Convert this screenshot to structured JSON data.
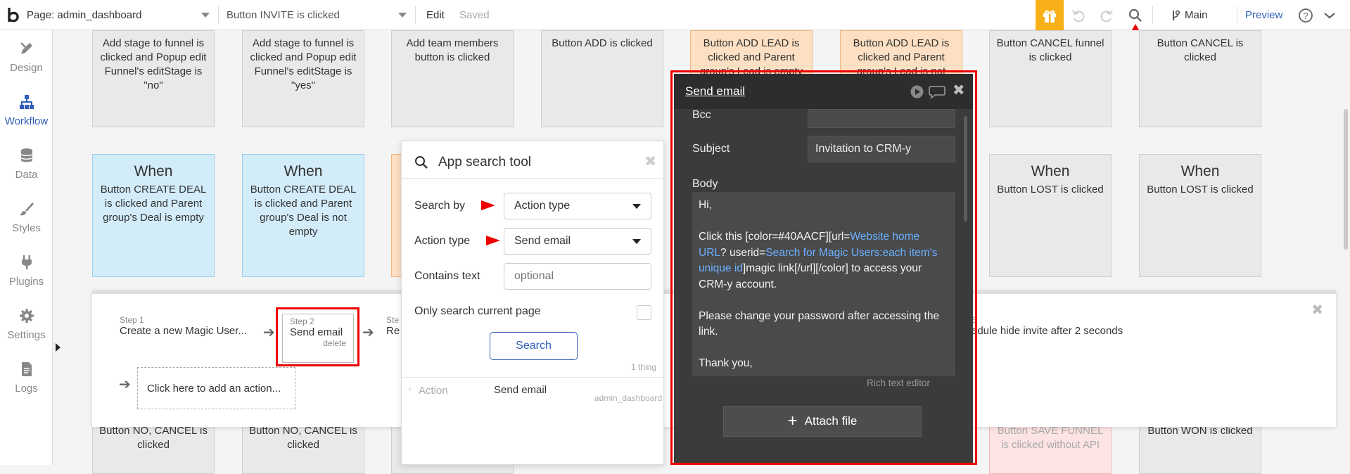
{
  "topbar": {
    "page_label": "Page: admin_dashboard",
    "workflow_label": "Button INVITE is clicked",
    "edit_label": "Edit",
    "saved_label": "Saved",
    "branch_label": "Main",
    "preview_label": "Preview"
  },
  "sidebar": {
    "items": [
      {
        "label": "Design",
        "icon": "design-icon"
      },
      {
        "label": "Workflow",
        "icon": "workflow-icon"
      },
      {
        "label": "Data",
        "icon": "database-icon"
      },
      {
        "label": "Styles",
        "icon": "brush-icon"
      },
      {
        "label": "Plugins",
        "icon": "plug-icon"
      },
      {
        "label": "Settings",
        "icon": "gear-icon"
      },
      {
        "label": "Logs",
        "icon": "document-icon"
      }
    ]
  },
  "cards": {
    "row1": [
      "Add stage to funnel is clicked and Popup edit Funnel's editStage is \"no\"",
      "Add stage to funnel is clicked and Popup edit Funnel's editStage is \"yes\"",
      "Add team members button is clicked",
      "Button ADD is clicked",
      "Button ADD LEAD is clicked and Parent group's Lead is empty",
      "Button ADD LEAD is clicked and Parent group's Lead is not empty",
      "Button CANCEL funnel is clicked",
      "Button CANCEL is clicked"
    ],
    "when_label": "When",
    "row2": [
      "Button CREATE DEAL is clicked and Parent group's Deal is empty",
      "Button CREATE DEAL is clicked and Parent group's Deal is not empty",
      "Button LOST is clicked",
      "Button LOST is clicked"
    ],
    "row3": [
      "Button NO, CANCEL is clicked",
      "Button NO, CANCEL is clicked",
      "Button SAVE FUNNEL is clicked without API",
      "Button WON is clicked"
    ]
  },
  "steps": {
    "step1_label": "Step 1",
    "step1_title": "Create a new Magic User...",
    "step2_label": "Step 2",
    "step2_title": "Send email",
    "step2_delete": "delete",
    "step3_fragment": "Re",
    "step6_fragment": "edule hide invite after 2 seconds",
    "add_action": "Click here to add an action..."
  },
  "search_tool": {
    "title": "App search tool",
    "search_by_label": "Search by",
    "search_by_value": "Action type",
    "action_type_label": "Action type",
    "action_type_value": "Send email",
    "contains_text_label": "Contains text",
    "contains_text_placeholder": "optional",
    "only_current_label": "Only search current page",
    "search_button": "Search",
    "result_count": "1 thing",
    "result_type": "Action",
    "result_name": "Send email",
    "result_page": "admin_dashboard"
  },
  "email": {
    "title": "Send email",
    "bcc_label": "Bcc",
    "subject_label": "Subject",
    "subject_value": "Invitation to CRM-y",
    "body_label": "Body",
    "body_hi": "Hi,",
    "body_click": "Click this [color=#40AACF][url=",
    "body_dyn1": "Website home URL",
    "body_q": "?",
    "body_userid": "userid=",
    "body_dyn2": "Search for Magic Users:each item's unique id",
    "body_rest": "]magic link[/url][/color] to access your CRM-y account.",
    "body_change": "Please change your password after accessing the link.",
    "body_thanks": "Thank you,",
    "rich_text_label": "Rich text editor",
    "attach_label": "Attach file"
  }
}
